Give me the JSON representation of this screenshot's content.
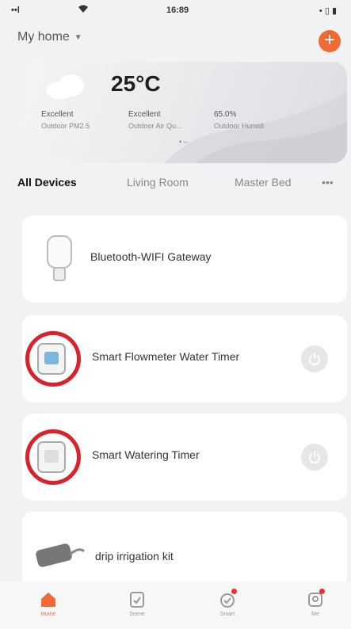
{
  "status_bar": {
    "signal": "••l",
    "time": "16:89",
    "battery": "• ▯ ▮"
  },
  "header": {
    "home_name": "My home",
    "add_label": "+"
  },
  "weather": {
    "temperature": "25°C",
    "stats": [
      {
        "label": "Excellent",
        "sub": "Outdoor PM2.5"
      },
      {
        "label": "Excellent",
        "sub": "Outdoor Air Qu..."
      },
      {
        "label": "65.0%",
        "sub": "Outdoor Humidi"
      }
    ],
    "pager": "• –"
  },
  "tabs": {
    "items": [
      "All Devices",
      "Living Room",
      "Master Bed"
    ],
    "more": "•••",
    "active_index": 0
  },
  "devices": [
    {
      "name": "Bluetooth-WIFI Gateway",
      "highlighted": false,
      "has_power": false
    },
    {
      "name": "Smart Flowmeter Water Timer",
      "highlighted": true,
      "has_power": true
    },
    {
      "name": "Smart Watering Timer",
      "highlighted": true,
      "has_power": true
    },
    {
      "name": "drip irrigation kit",
      "highlighted": false,
      "has_power": false
    }
  ],
  "bottom_nav": {
    "items": [
      {
        "label": "Home",
        "icon": "home-icon",
        "active": true,
        "badge": false
      },
      {
        "label": "Scene",
        "icon": "scene-icon",
        "active": false,
        "badge": false
      },
      {
        "label": "Smart",
        "icon": "smart-icon",
        "active": false,
        "badge": true
      },
      {
        "label": "Me",
        "icon": "me-icon",
        "active": false,
        "badge": true
      }
    ]
  },
  "colors": {
    "accent": "#f06a33",
    "highlight": "#d9222a",
    "background": "#f2f2f4"
  }
}
